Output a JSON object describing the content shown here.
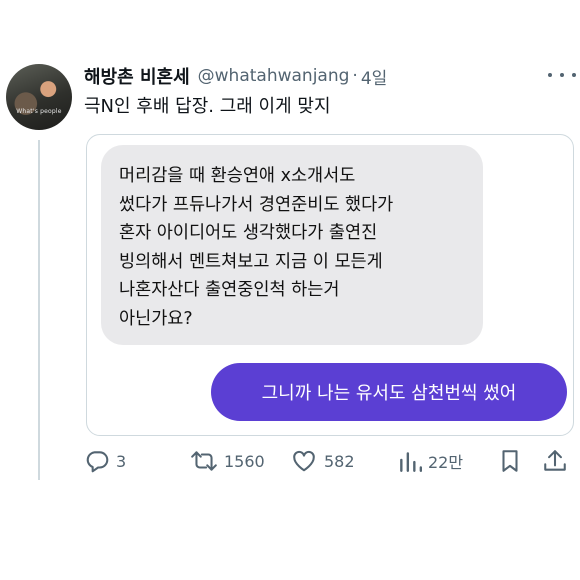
{
  "author": {
    "display_name": "해방촌 비혼세",
    "handle": "@whatahwanjang",
    "separator": "·",
    "time": "4일",
    "avatar_caption": "What's people"
  },
  "tweet": {
    "text": "극N인 후배 답장. 그래 이게 맞지"
  },
  "media": {
    "received_lines": [
      "머리감을 때 환승연애 x소개서도",
      "썼다가 프듀나가서 경연준비도 했다가",
      "혼자 아이디어도 생각했다가 출연진",
      "빙의해서 멘트쳐보고 지금 이 모든게",
      "나혼자산다 출연중인척 하는거",
      "아닌가요?"
    ],
    "sent": "그니까 나는 유서도 삼천번씩 썼어",
    "received_bubble_color": "#e9e9eb",
    "sent_bubble_color": "#5b3fd3"
  },
  "actions": {
    "replies": "3",
    "retweets": "1560",
    "likes": "582",
    "views": "22만"
  },
  "icons": [
    "more-icon",
    "reply-icon",
    "retweet-icon",
    "like-icon",
    "views-icon",
    "bookmark-icon",
    "share-icon"
  ],
  "colors": {
    "text": "#0f1419",
    "secondary": "#536471",
    "border": "#cfd9de"
  }
}
